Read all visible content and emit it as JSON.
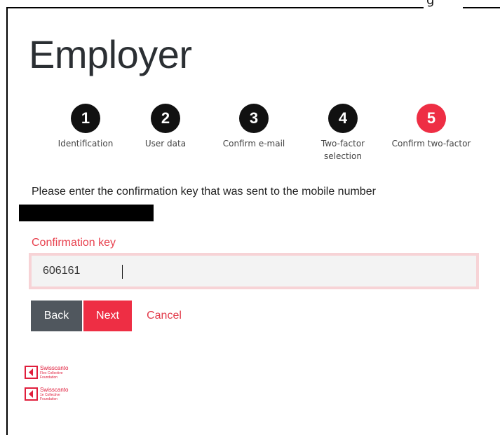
{
  "header": {
    "clipped_text": "g",
    "title": "Employer"
  },
  "steps": [
    {
      "number": "1",
      "label": "Identification",
      "state": "done"
    },
    {
      "number": "2",
      "label": "User data",
      "state": "done"
    },
    {
      "number": "3",
      "label": "Confirm e-mail",
      "state": "done"
    },
    {
      "number": "4",
      "label": "Two-factor selection",
      "state": "done"
    },
    {
      "number": "5",
      "label": "Confirm two-factor",
      "state": "active"
    }
  ],
  "form": {
    "instruction": "Please enter the confirmation key that was sent to the mobile number",
    "field_label": "Confirmation key",
    "field_value": "606161"
  },
  "actions": {
    "back": "Back",
    "next": "Next",
    "cancel": "Cancel"
  },
  "footer": {
    "logos": [
      {
        "brand": "Swisscanto",
        "line1": "Flex Collective",
        "line2": "Foundation"
      },
      {
        "brand": "Swisscanto",
        "line1": "1e Collective",
        "line2": "Foundation"
      }
    ]
  },
  "colors": {
    "accent": "#ee2e44",
    "dark_button": "#50575e",
    "step_done": "#111111",
    "label_red": "#e8424f"
  },
  "icons": {
    "logo": "swisscanto-chevron-icon"
  }
}
